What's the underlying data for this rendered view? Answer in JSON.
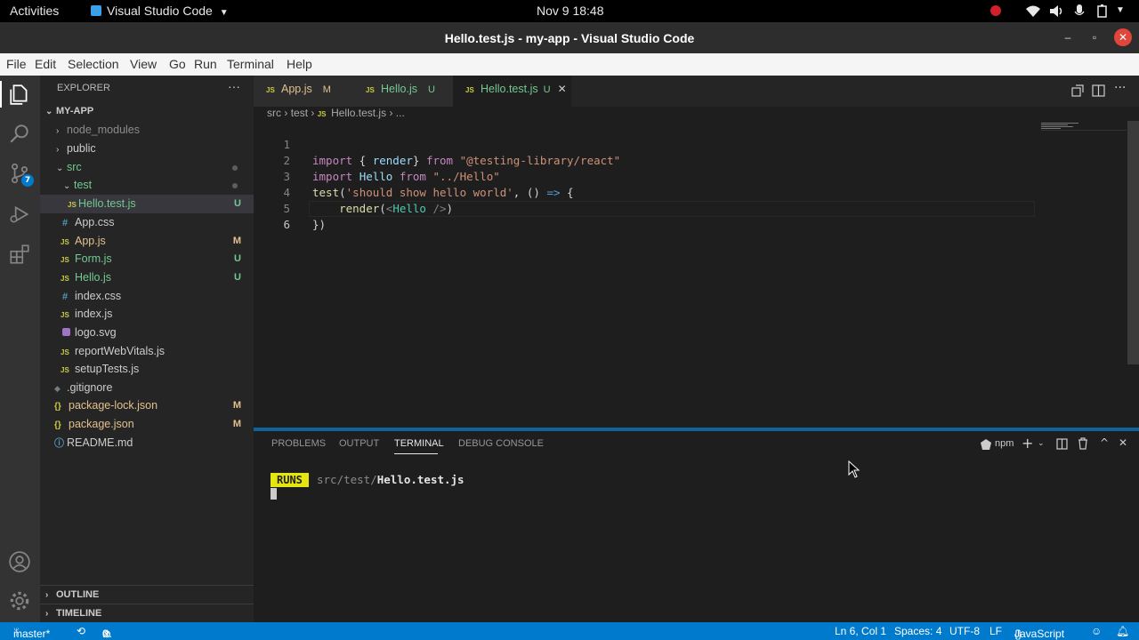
{
  "gnome": {
    "activities": "Activities",
    "app_name": "Visual Studio Code",
    "clock": "Nov 9  18:48"
  },
  "window": {
    "title": "Hello.test.js - my-app - Visual Studio Code"
  },
  "menu": [
    "File",
    "Edit",
    "Selection",
    "View",
    "Go",
    "Run",
    "Terminal",
    "Help"
  ],
  "sidebar": {
    "header": "EXPLORER",
    "more": "···",
    "project": "MY-APP",
    "items": [
      {
        "label": "node_modules",
        "badge": ""
      },
      {
        "label": "public",
        "badge": ""
      },
      {
        "label": "src",
        "badge": ""
      },
      {
        "label": "test",
        "badge": ""
      },
      {
        "label": "Hello.test.js",
        "badge": "U"
      },
      {
        "label": "App.css",
        "badge": ""
      },
      {
        "label": "App.js",
        "badge": "M"
      },
      {
        "label": "Form.js",
        "badge": "U"
      },
      {
        "label": "Hello.js",
        "badge": "U"
      },
      {
        "label": "index.css",
        "badge": ""
      },
      {
        "label": "index.js",
        "badge": ""
      },
      {
        "label": "logo.svg",
        "badge": ""
      },
      {
        "label": "reportWebVitals.js",
        "badge": ""
      },
      {
        "label": "setupTests.js",
        "badge": ""
      },
      {
        "label": ".gitignore",
        "badge": ""
      },
      {
        "label": "package-lock.json",
        "badge": "M"
      },
      {
        "label": "package.json",
        "badge": "M"
      },
      {
        "label": "README.md",
        "badge": ""
      }
    ],
    "outline": "OUTLINE",
    "timeline": "TIMELINE",
    "scm_badge": "7"
  },
  "icons": {
    "js": "JS",
    "css": "#",
    "json": "{}",
    "svg": "logo-svg-icon"
  },
  "tabs": [
    {
      "label": "App.js",
      "status": "M"
    },
    {
      "label": "Hello.js",
      "status": "U"
    },
    {
      "label": "Hello.test.js",
      "status": "U"
    }
  ],
  "breadcrumb": {
    "p1": "src",
    "p2": "test",
    "p3": "Hello.test.js",
    "p4": "..."
  },
  "code": {
    "line_numbers": [
      "1",
      "2",
      "3",
      "4",
      "5",
      "6"
    ],
    "l1": {
      "kw1": "import",
      "b1": " { ",
      "var1": "render",
      "b2": "} ",
      "kw2": "from",
      "sp": " ",
      "str": "\"@testing-library/react\""
    },
    "l2": {
      "kw1": "import",
      "sp1": " ",
      "var1": "Hello",
      "sp2": " ",
      "kw2": "from",
      "sp3": " ",
      "str": "\"../Hello\""
    },
    "l3": {
      "fn": "test",
      "p1": "(",
      "str": "'should show hello world'",
      "p2": ", () ",
      "arrow": "=>",
      "p3": " {"
    },
    "l4": {
      "indent": "    ",
      "fn": "render",
      "p1": "(",
      "lt": "<",
      "cmp": "Hello",
      "sl": " />",
      "p2": ")"
    },
    "l5": {
      "text": "})"
    }
  },
  "panel": {
    "tabs": [
      "PROBLEMS",
      "OUTPUT",
      "TERMINAL",
      "DEBUG CONSOLE"
    ],
    "shell": "npm",
    "runs_badge": "RUNS",
    "path_dim": "src/test/",
    "path_file": "Hello.test.js"
  },
  "status": {
    "branch": "master*",
    "errors": "0",
    "warnings": "0",
    "position": "Ln 6, Col 1",
    "spaces": "Spaces: 4",
    "encoding": "UTF-8",
    "eol": "LF",
    "language": "JavaScript"
  },
  "colors": {
    "accent": "#007acc",
    "runs_bg": "#e5e510",
    "modified": "#e2c08d",
    "untracked": "#73c991"
  }
}
